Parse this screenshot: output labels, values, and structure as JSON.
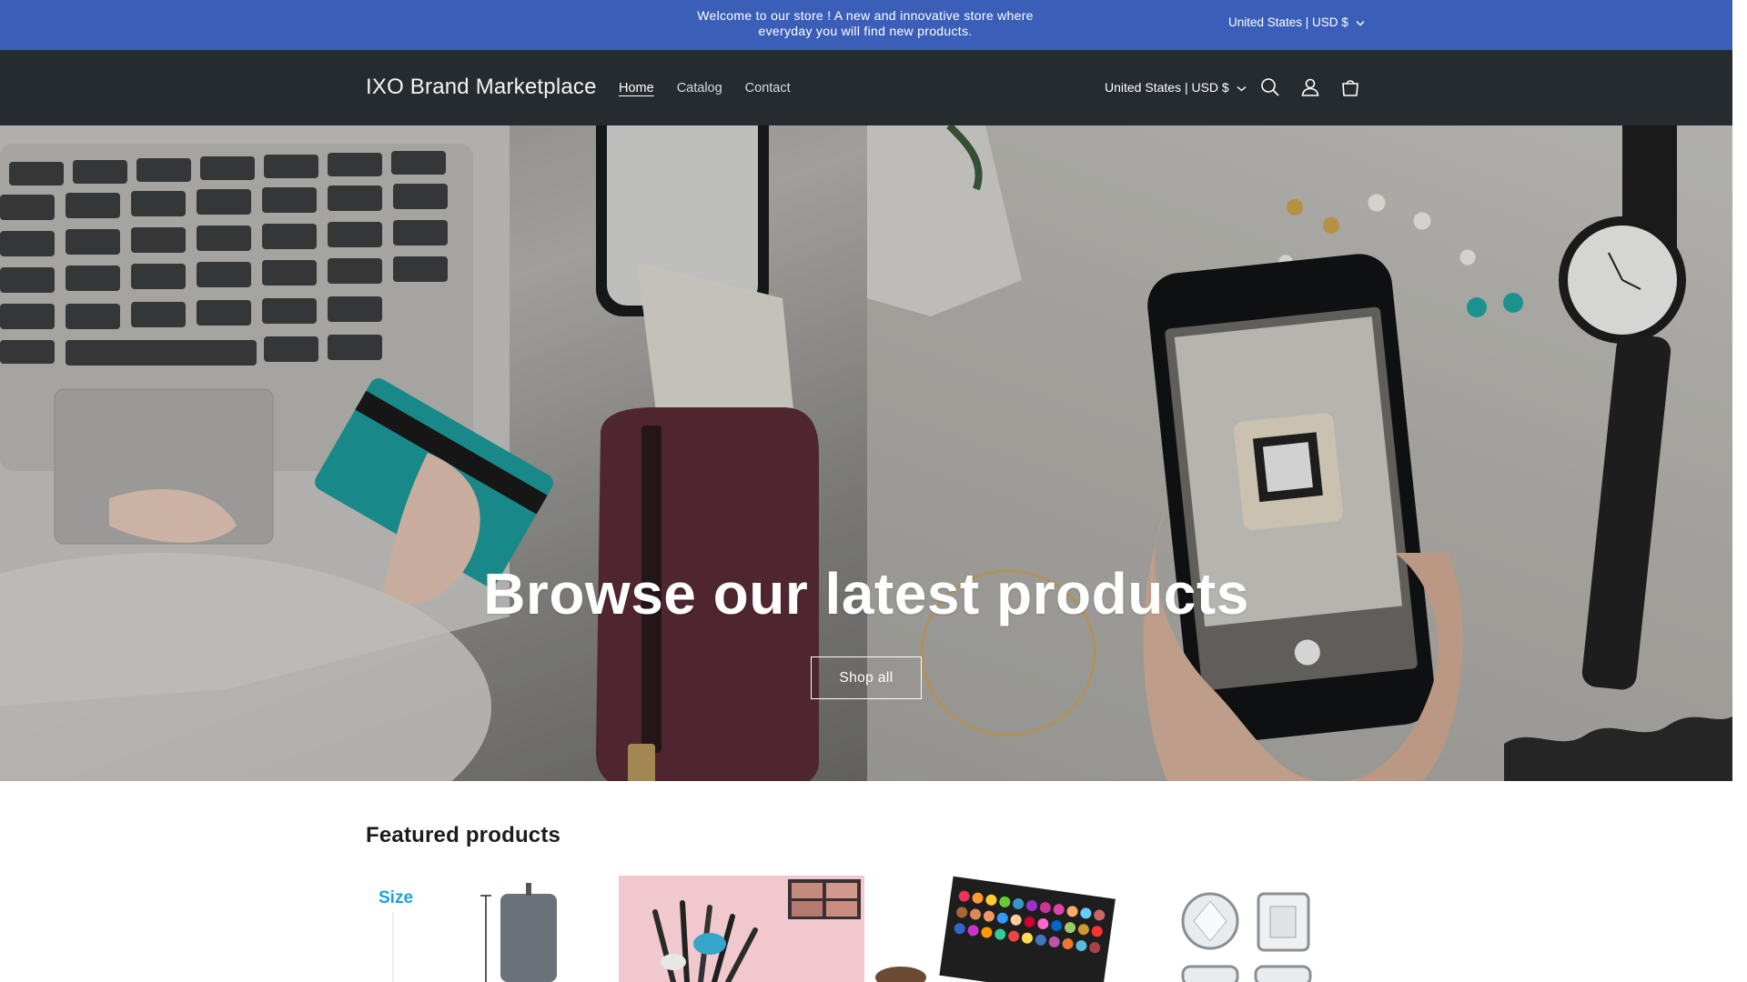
{
  "announcement": {
    "text": "Welcome to our store ! A new and innovative store where everyday you will find new products.",
    "country": "United States | USD $"
  },
  "header": {
    "logo": "IXO Brand Marketplace",
    "nav": [
      "Home",
      "Catalog",
      "Contact"
    ],
    "active_nav": "Home",
    "country": "United States | USD $",
    "icons": [
      "search-icon",
      "account-icon",
      "cart-icon"
    ]
  },
  "hero": {
    "title": "Browse our latest products",
    "button": "Shop all"
  },
  "featured": {
    "title": "Featured products",
    "card1_label": "Size"
  },
  "colors": {
    "announcement_bg": "#3b5fb8",
    "header_bg": "#262b30",
    "card_accent": "#1aa3dc"
  }
}
